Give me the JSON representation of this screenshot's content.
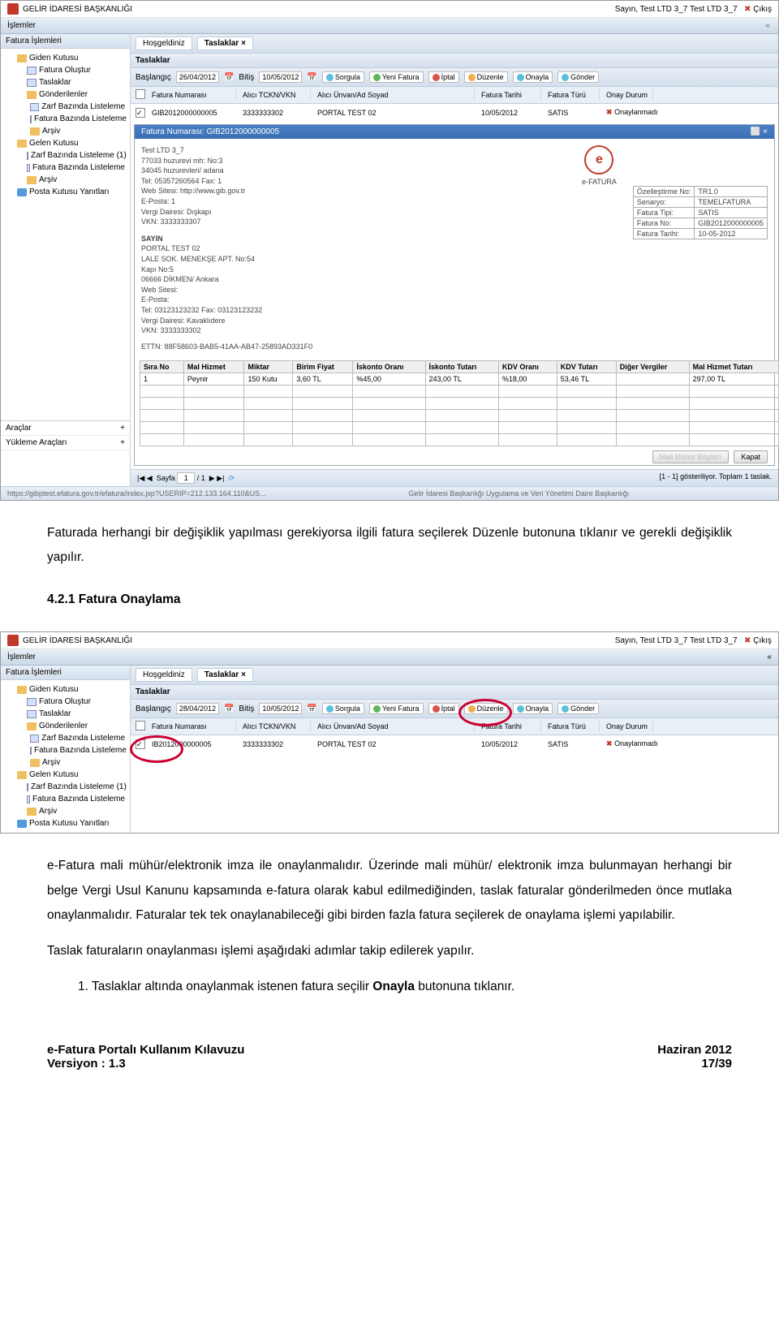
{
  "app": {
    "title": "GELİR İDARESİ BAŞKANLIĞI",
    "user_line": "Sayın, Test LTD 3_7 Test LTD 3_7",
    "logout": "Çıkış",
    "menu_islemler": "İşlemler",
    "url": "https://gibptest.efatura.gov.tr/efatura/index.jsp?USERIP=212.133.164.110&US...",
    "footer_center": "Gelir İdaresi Başkanlığı Uygulama ve Veri Yönetimi Daire Başkanlığı"
  },
  "sidebar": {
    "head": "Fatura İşlemleri",
    "items": [
      "Giden Kutusu",
      "Fatura Oluştur",
      "Taslaklar",
      "Gönderilenler",
      "Zarf Bazında Listeleme",
      "Fatura Bazında Listeleme",
      "Arşiv",
      "Gelen Kutusu",
      "Zarf Bazında Listeleme (1)",
      "Fatura Bazında Listeleme",
      "Arşiv",
      "Posta Kutusu Yanıtları"
    ],
    "araclar": "Araçlar",
    "yukleme": "Yükleme Araçları"
  },
  "tabs": {
    "t1": "Hoşgeldiniz",
    "t2": "Taslaklar"
  },
  "toolbar": {
    "baslangic_lbl": "Başlangıç",
    "baslangic": "26/04/2012",
    "bitis_lbl": "Bitiş",
    "bitis": "10/05/2012",
    "sorgula": "Sorgula",
    "yeni": "Yeni Fatura",
    "iptal": "İptal",
    "duzenle": "Düzenle",
    "onayla": "Onayla",
    "gonder": "Gönder",
    "panel_title": "Taslaklar"
  },
  "grid": {
    "h1": "Fatura Numarası",
    "h2": "Alıcı TCKN/VKN",
    "h3": "Alıcı Ünvan/Ad Soyad",
    "h4": "Fatura Tarihi",
    "h5": "Fatura Türü",
    "h6": "Onay Durum",
    "c1": "GIB2012000000005",
    "c2": "3333333302",
    "c3": "PORTAL TEST 02",
    "c4": "10/05/2012",
    "c5": "SATIS",
    "c6": "Onaylanmadı"
  },
  "detail": {
    "title": "Fatura Numarası: GIB2012000000005",
    "sender": {
      "name": "Test LTD 3_7",
      "l1": "77033 huzurevi mh: No:3",
      "l2": "34045 huzurevleri/ adana",
      "l3": "Tel: 05357260564 Fax: 1",
      "l4": "Web Sitesi: http://www.gib.gov.tr",
      "l5": "E-Posta: 1",
      "l6": "Vergi Dairesi: Dışkapı",
      "l7": "VKN: 3333333307"
    },
    "efatura_lbl": "e-FATURA",
    "sayin": "SAYIN",
    "receiver": {
      "name": "PORTAL TEST 02",
      "l1": "LALE SOK. MENEKŞE APT. No:54",
      "l2": "Kapı No:5",
      "l3": "06666 DİKMEN/ Ankara",
      "l4": "Web Sitesi:",
      "l5": "E-Posta:",
      "l6": "Tel: 03123123232 Fax: 03123123232",
      "l7": "Vergi Dairesi: Kavaklıdere",
      "l8": "VKN: 3333333302"
    },
    "ettn": "ETTN: 88F58603-BAB5-41AA-AB47-25893AD331F0",
    "meta": {
      "k1": "Özelleştirme No:",
      "v1": "TR1.0",
      "k2": "Senaryo:",
      "v2": "TEMELFATURA",
      "k3": "Fatura Tipi:",
      "v3": "SATIS",
      "k4": "Fatura No:",
      "v4": "GIB2012000000005",
      "k5": "Fatura Tarihi:",
      "v5": "10-05-2012"
    },
    "cols": {
      "c1": "Sıra No",
      "c2": "Mal Hizmet",
      "c3": "Miktar",
      "c4": "Birim Fiyat",
      "c5": "İskonto Oranı",
      "c6": "İskonto Tutarı",
      "c7": "KDV Oranı",
      "c8": "KDV Tutarı",
      "c9": "Diğer Vergiler",
      "c10": "Mal Hizmet Tutarı"
    },
    "row": {
      "c1": "1",
      "c2": "Peynir",
      "c3": "150 Kutu",
      "c4": "3,60 TL",
      "c5": "%45,00",
      "c6": "243,00 TL",
      "c7": "%18,00",
      "c8": "53,46 TL",
      "c9": "",
      "c10": "297,00 TL"
    },
    "btn1": "Mali Mühür Bilgileri",
    "btn2": "Kapat"
  },
  "pager": {
    "sayfa": "Sayfa",
    "val": "1",
    "of": "/ 1",
    "right": "[1 - 1] gösteriliyor. Toplam 1 taslak."
  },
  "doc": {
    "p1": "Faturada herhangi bir değişiklik yapılması gerekiyorsa ilgili fatura seçilerek Düzenle butonuna tıklanır ve gerekli değişiklik yapılır.",
    "sec": "4.2.1 Fatura Onaylama",
    "p2": "e-Fatura mali mühür/elektronik imza ile onaylanmalıdır. Üzerinde mali mühür/ elektronik imza bulunmayan herhangi bir belge Vergi Usul Kanunu kapsamında e-fatura olarak kabul edilmediğinden, taslak faturalar gönderilmeden önce mutlaka onaylanmalıdır. Faturalar tek tek onaylanabileceği gibi birden fazla fatura seçilerek de onaylama işlemi yapılabilir.",
    "p3": "Taslak faturaların onaylanması işlemi aşağıdaki adımlar takip edilerek yapılır.",
    "li1": "1. Taslaklar altında onaylanmak istenen fatura seçilir Onayla butonuna tıklanır.",
    "foot_l1": "e-Fatura Portalı Kullanım Kılavuzu",
    "foot_l2": "Versiyon : 1.3",
    "foot_r1": "Haziran 2012",
    "foot_r2": "17/39",
    "baslangic2": "28/04/2012",
    "grid_c1_2": "IB2012000000005"
  }
}
